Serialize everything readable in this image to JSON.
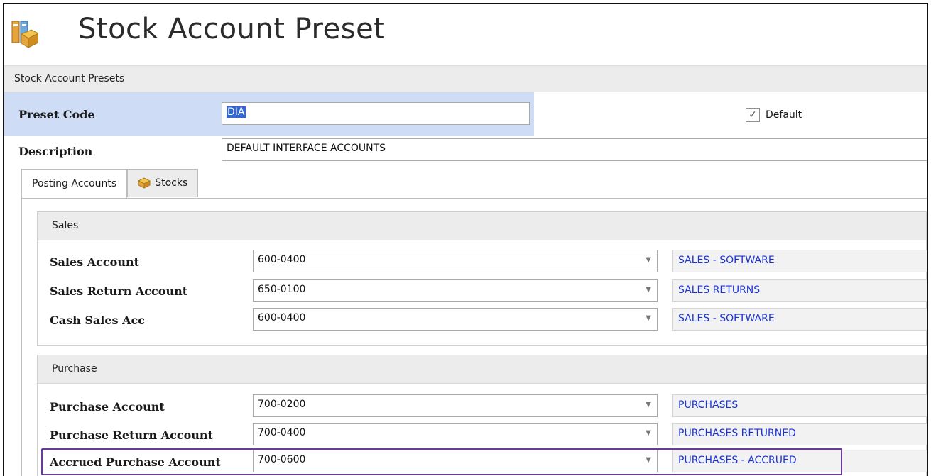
{
  "window": {
    "title": "Stock Account Preset",
    "icon": "stock-app-icon"
  },
  "section": {
    "label": "Stock Account Presets"
  },
  "preset": {
    "code_label": "Preset Code",
    "code_value": "DIA",
    "description_label": "Description",
    "description_value": "DEFAULT INTERFACE ACCOUNTS",
    "default_label": "Default",
    "default_checked": true
  },
  "tabs": [
    {
      "label": "Posting Accounts",
      "active": true
    },
    {
      "label": "Stocks",
      "active": false,
      "icon": "box-icon"
    }
  ],
  "sales": {
    "title": "Sales",
    "rows": [
      {
        "label": "Sales Account",
        "code": "600-0400",
        "desc": "SALES - SOFTWARE"
      },
      {
        "label": "Sales Return Account",
        "code": "650-0100",
        "desc": "SALES RETURNS"
      },
      {
        "label": "Cash Sales Acc",
        "code": "600-0400",
        "desc": "SALES - SOFTWARE"
      }
    ]
  },
  "purchase": {
    "title": "Purchase",
    "rows": [
      {
        "label": "Purchase Account",
        "code": "700-0200",
        "desc": "PURCHASES"
      },
      {
        "label": "Purchase Return Account",
        "code": "700-0400",
        "desc": "PURCHASES RETURNED"
      },
      {
        "label": "Accrued Purchase Account",
        "code": "700-0600",
        "desc": "PURCHASES - ACCRUED"
      }
    ]
  },
  "colors": {
    "accent": "#3367d6",
    "link_text": "#1a33d6",
    "highlight": "#6b3a9e"
  }
}
